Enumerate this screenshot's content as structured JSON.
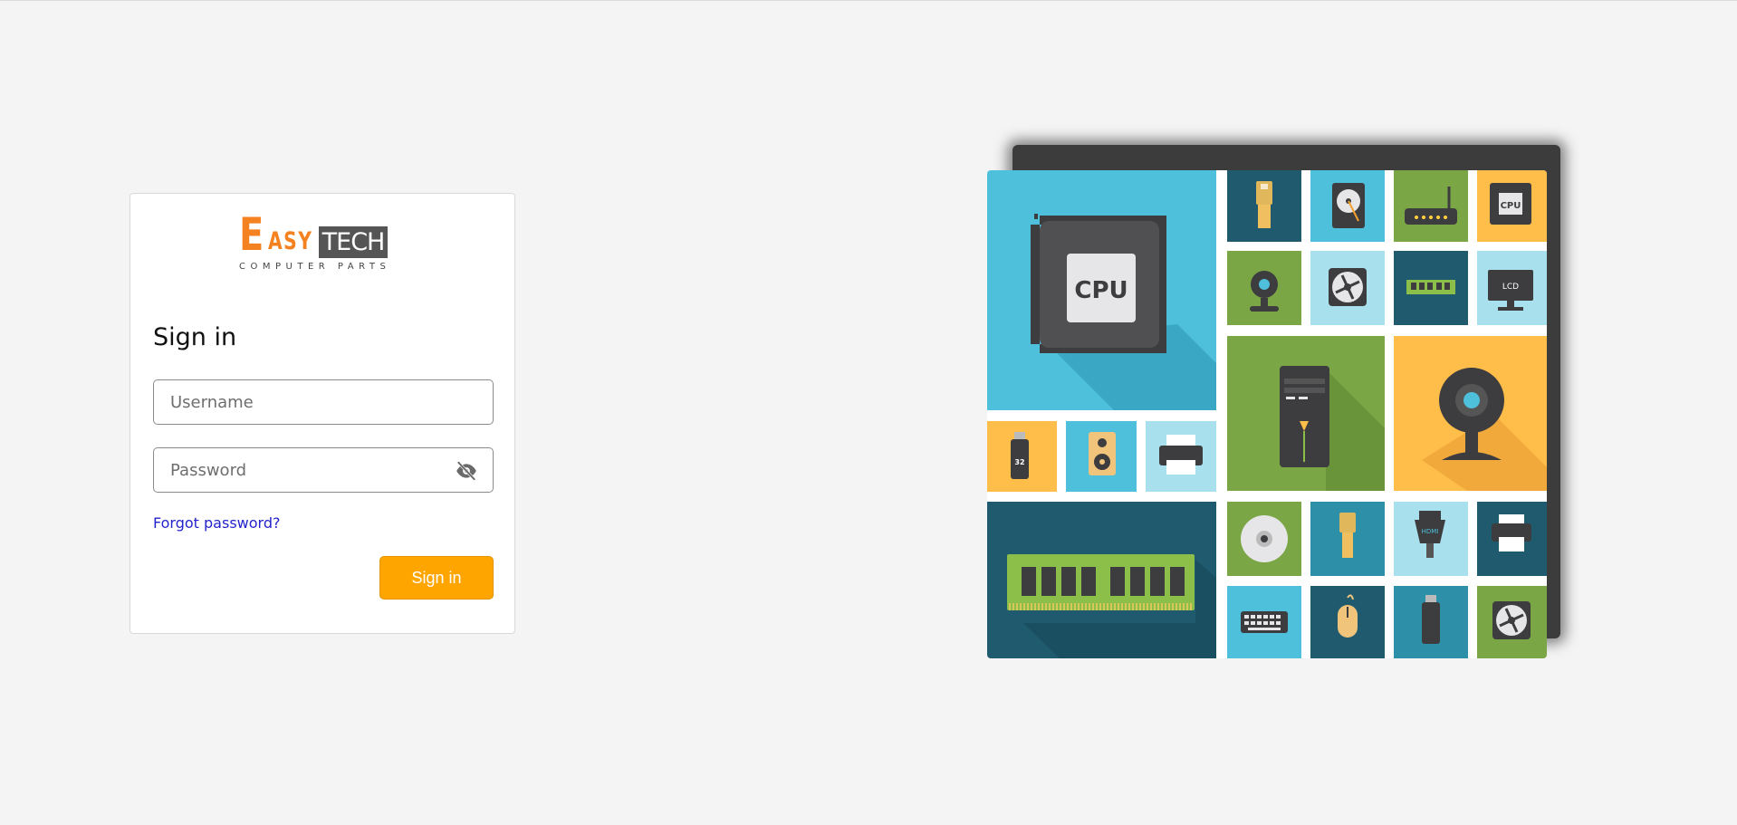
{
  "logo": {
    "initial": "E",
    "rest": "ASY",
    "tech": "TECH",
    "tagline": "COMPUTER PARTS"
  },
  "signin": {
    "title": "Sign in",
    "username_placeholder": "Username",
    "password_placeholder": "Password",
    "forgot_label": "Forgot password?",
    "button_label": "Sign in"
  },
  "illustration": {
    "labels": {
      "cpu_big": "CPU",
      "cpu_small": "CPU",
      "lcd": "LCD",
      "usb_capacity": "32",
      "hdmi": "HDMI"
    }
  },
  "colors": {
    "accent": "#ffa500",
    "logo_orange": "#f58220",
    "link": "#2424cc",
    "tile_sky": "#4ec0dc",
    "tile_light": "#a8e0ee",
    "tile_navy": "#1f5a6e",
    "tile_green": "#7aa645",
    "tile_yellow": "#ffbd4a",
    "tile_teal": "#2e8fa8"
  }
}
